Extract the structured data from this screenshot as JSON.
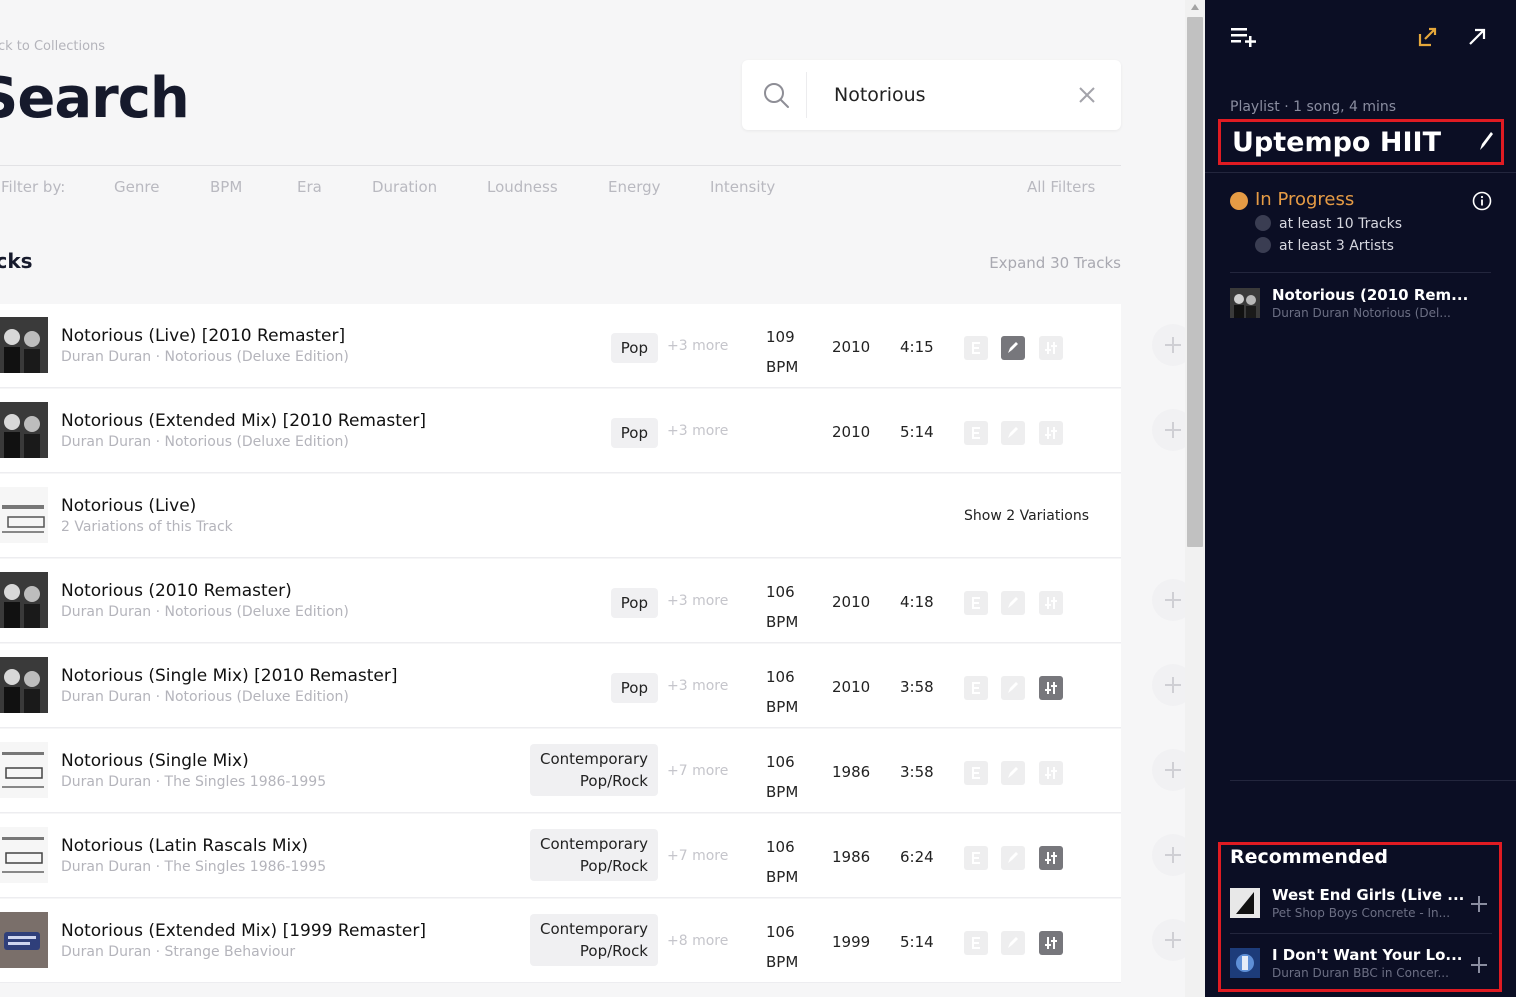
{
  "header": {
    "back_link": "ack to Collections",
    "title": "Search"
  },
  "search": {
    "value": "Notorious",
    "placeholder": ""
  },
  "filters": {
    "label": "Filter by:",
    "items": [
      "Genre",
      "BPM",
      "Era",
      "Duration",
      "Loudness",
      "Energy",
      "Intensity"
    ],
    "all": "All Filters"
  },
  "tracks_section": {
    "title": "acks",
    "expand": "Expand 30 Tracks"
  },
  "rows": [
    {
      "title": "Notorious (Live) [2010 Remaster]",
      "subtitle": "Duran Duran · Notorious (Deluxe Edition)",
      "genre": "Pop",
      "more": "+3 more",
      "bpm": "109",
      "bpm_unit": "BPM",
      "year": "2010",
      "duration": "4:15"
    },
    {
      "title": "Notorious (Extended Mix) [2010 Remaster]",
      "subtitle": "Duran Duran · Notorious (Deluxe Edition)",
      "genre": "Pop",
      "more": "+3 more",
      "bpm": "",
      "bpm_unit": "",
      "year": "2010",
      "duration": "5:14"
    },
    {
      "title": "Notorious (Live)",
      "subtitle": "2 Variations of this Track",
      "variations": "Show 2 Variations"
    },
    {
      "title": "Notorious (2010 Remaster)",
      "subtitle": "Duran Duran · Notorious (Deluxe Edition)",
      "genre": "Pop",
      "more": "+3 more",
      "bpm": "106",
      "bpm_unit": "BPM",
      "year": "2010",
      "duration": "4:18"
    },
    {
      "title": "Notorious (Single Mix) [2010 Remaster]",
      "subtitle": "Duran Duran · Notorious (Deluxe Edition)",
      "genre": "Pop",
      "more": "+3 more",
      "bpm": "106",
      "bpm_unit": "BPM",
      "year": "2010",
      "duration": "3:58"
    },
    {
      "title": "Notorious (Single Mix)",
      "subtitle": "Duran Duran · The Singles 1986-1995",
      "genre_line1": "Contemporary",
      "genre_line2": "Pop/Rock",
      "more": "+7 more",
      "bpm": "106",
      "bpm_unit": "BPM",
      "year": "1986",
      "duration": "3:58"
    },
    {
      "title": "Notorious (Latin Rascals Mix)",
      "subtitle": "Duran Duran · The Singles 1986-1995",
      "genre_line1": "Contemporary",
      "genre_line2": "Pop/Rock",
      "more": "+7 more",
      "bpm": "106",
      "bpm_unit": "BPM",
      "year": "1986",
      "duration": "6:24"
    },
    {
      "title": "Notorious (Extended Mix) [1999 Remaster]",
      "subtitle": "Duran Duran · Strange Behaviour",
      "genre_line1": "Contemporary",
      "genre_line2": "Pop/Rock",
      "more": "+8 more",
      "bpm": "106",
      "bpm_unit": "BPM",
      "year": "1999",
      "duration": "5:14"
    }
  ],
  "playlist": {
    "meta": "Playlist · 1 song, 4 mins",
    "title": "Uptempo HIIT",
    "status": "In Progress",
    "requirements": [
      "at least 10 Tracks",
      "at least 3 Artists"
    ],
    "tracks": [
      {
        "title": "Notorious (2010 Rem...",
        "subtitle": "Duran Duran Notorious (Del..."
      }
    ]
  },
  "recommended": {
    "title": "Recommended",
    "items": [
      {
        "title": "West End Girls (Live ...",
        "subtitle": "Pet Shop Boys Concrete - In..."
      },
      {
        "title": "I Don't Want Your Lo...",
        "subtitle": "Duran Duran BBC in Concer..."
      }
    ]
  },
  "colors": {
    "panel_bg": "#0b0e24",
    "accent_orange": "#e59b45",
    "highlight_red": "#e01b22"
  }
}
